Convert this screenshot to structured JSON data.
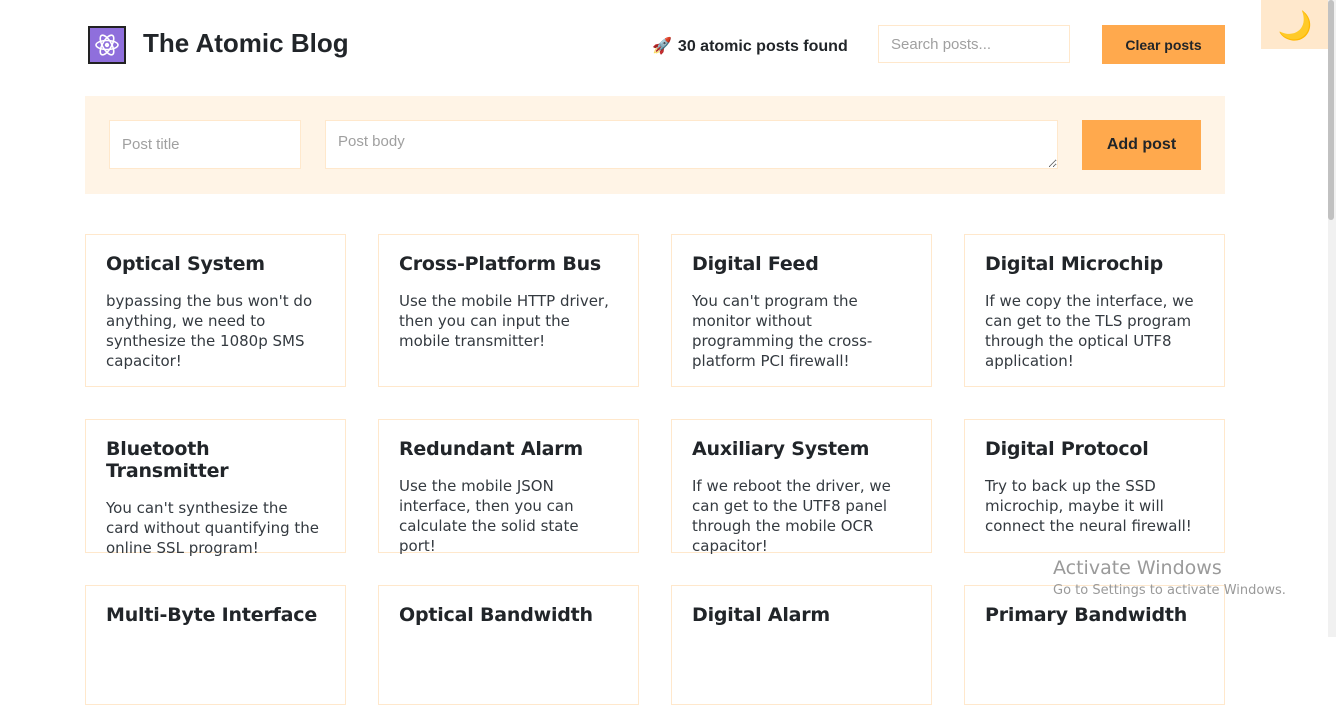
{
  "header": {
    "logo_icon": "atom-icon",
    "title": "The Atomic Blog",
    "count_icon": "rocket-icon",
    "count_text": "30 atomic posts found",
    "search_placeholder": "Search posts...",
    "clear_label": "Clear posts",
    "dark_mode_icon": "moon-icon",
    "dark_mode_glyph": "🌙"
  },
  "form": {
    "title_placeholder": "Post title",
    "body_placeholder": "Post body",
    "add_label": "Add post"
  },
  "posts": [
    {
      "title": "Optical System",
      "body": "bypassing the bus won't do anything, we need to synthesize the 1080p SMS capacitor!"
    },
    {
      "title": "Cross-Platform Bus",
      "body": "Use the mobile HTTP driver, then you can input the mobile transmitter!"
    },
    {
      "title": "Digital Feed",
      "body": "You can't program the monitor without programming the cross-platform PCI firewall!"
    },
    {
      "title": "Digital Microchip",
      "body": "If we copy the interface, we can get to the TLS program through the optical UTF8 application!"
    },
    {
      "title": "Bluetooth Transmitter",
      "body": "You can't synthesize the card without quantifying the online SSL program!"
    },
    {
      "title": "Redundant Alarm",
      "body": "Use the mobile JSON interface, then you can calculate the solid state port!"
    },
    {
      "title": "Auxiliary System",
      "body": "If we reboot the driver, we can get to the UTF8 panel through the mobile OCR capacitor!"
    },
    {
      "title": "Digital Protocol",
      "body": "Try to back up the SSD microchip, maybe it will connect the neural firewall!"
    },
    {
      "title": "Multi-Byte Interface",
      "body": ""
    },
    {
      "title": "Optical Bandwidth",
      "body": ""
    },
    {
      "title": "Digital Alarm",
      "body": ""
    },
    {
      "title": "Primary Bandwidth",
      "body": ""
    }
  ],
  "watermark": {
    "line1": "Activate Windows",
    "line2": "Go to Settings to activate Windows."
  },
  "colors": {
    "accent": "#ffa94d",
    "accent_light": "#fff4e6",
    "border": "#ffe8cc",
    "logo_bg": "#8f6fdc"
  }
}
